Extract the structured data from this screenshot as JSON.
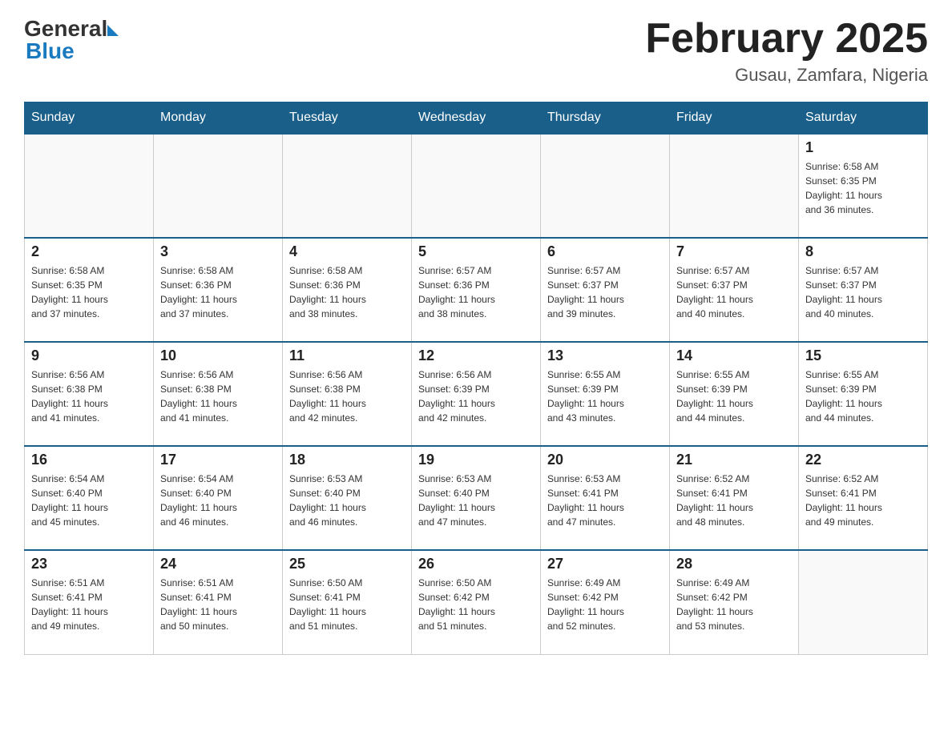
{
  "header": {
    "logo_general": "General",
    "logo_blue": "Blue",
    "month_title": "February 2025",
    "location": "Gusau, Zamfara, Nigeria"
  },
  "days_of_week": [
    "Sunday",
    "Monday",
    "Tuesday",
    "Wednesday",
    "Thursday",
    "Friday",
    "Saturday"
  ],
  "weeks": [
    [
      {
        "day": "",
        "info": ""
      },
      {
        "day": "",
        "info": ""
      },
      {
        "day": "",
        "info": ""
      },
      {
        "day": "",
        "info": ""
      },
      {
        "day": "",
        "info": ""
      },
      {
        "day": "",
        "info": ""
      },
      {
        "day": "1",
        "info": "Sunrise: 6:58 AM\nSunset: 6:35 PM\nDaylight: 11 hours\nand 36 minutes."
      }
    ],
    [
      {
        "day": "2",
        "info": "Sunrise: 6:58 AM\nSunset: 6:35 PM\nDaylight: 11 hours\nand 37 minutes."
      },
      {
        "day": "3",
        "info": "Sunrise: 6:58 AM\nSunset: 6:36 PM\nDaylight: 11 hours\nand 37 minutes."
      },
      {
        "day": "4",
        "info": "Sunrise: 6:58 AM\nSunset: 6:36 PM\nDaylight: 11 hours\nand 38 minutes."
      },
      {
        "day": "5",
        "info": "Sunrise: 6:57 AM\nSunset: 6:36 PM\nDaylight: 11 hours\nand 38 minutes."
      },
      {
        "day": "6",
        "info": "Sunrise: 6:57 AM\nSunset: 6:37 PM\nDaylight: 11 hours\nand 39 minutes."
      },
      {
        "day": "7",
        "info": "Sunrise: 6:57 AM\nSunset: 6:37 PM\nDaylight: 11 hours\nand 40 minutes."
      },
      {
        "day": "8",
        "info": "Sunrise: 6:57 AM\nSunset: 6:37 PM\nDaylight: 11 hours\nand 40 minutes."
      }
    ],
    [
      {
        "day": "9",
        "info": "Sunrise: 6:56 AM\nSunset: 6:38 PM\nDaylight: 11 hours\nand 41 minutes."
      },
      {
        "day": "10",
        "info": "Sunrise: 6:56 AM\nSunset: 6:38 PM\nDaylight: 11 hours\nand 41 minutes."
      },
      {
        "day": "11",
        "info": "Sunrise: 6:56 AM\nSunset: 6:38 PM\nDaylight: 11 hours\nand 42 minutes."
      },
      {
        "day": "12",
        "info": "Sunrise: 6:56 AM\nSunset: 6:39 PM\nDaylight: 11 hours\nand 42 minutes."
      },
      {
        "day": "13",
        "info": "Sunrise: 6:55 AM\nSunset: 6:39 PM\nDaylight: 11 hours\nand 43 minutes."
      },
      {
        "day": "14",
        "info": "Sunrise: 6:55 AM\nSunset: 6:39 PM\nDaylight: 11 hours\nand 44 minutes."
      },
      {
        "day": "15",
        "info": "Sunrise: 6:55 AM\nSunset: 6:39 PM\nDaylight: 11 hours\nand 44 minutes."
      }
    ],
    [
      {
        "day": "16",
        "info": "Sunrise: 6:54 AM\nSunset: 6:40 PM\nDaylight: 11 hours\nand 45 minutes."
      },
      {
        "day": "17",
        "info": "Sunrise: 6:54 AM\nSunset: 6:40 PM\nDaylight: 11 hours\nand 46 minutes."
      },
      {
        "day": "18",
        "info": "Sunrise: 6:53 AM\nSunset: 6:40 PM\nDaylight: 11 hours\nand 46 minutes."
      },
      {
        "day": "19",
        "info": "Sunrise: 6:53 AM\nSunset: 6:40 PM\nDaylight: 11 hours\nand 47 minutes."
      },
      {
        "day": "20",
        "info": "Sunrise: 6:53 AM\nSunset: 6:41 PM\nDaylight: 11 hours\nand 47 minutes."
      },
      {
        "day": "21",
        "info": "Sunrise: 6:52 AM\nSunset: 6:41 PM\nDaylight: 11 hours\nand 48 minutes."
      },
      {
        "day": "22",
        "info": "Sunrise: 6:52 AM\nSunset: 6:41 PM\nDaylight: 11 hours\nand 49 minutes."
      }
    ],
    [
      {
        "day": "23",
        "info": "Sunrise: 6:51 AM\nSunset: 6:41 PM\nDaylight: 11 hours\nand 49 minutes."
      },
      {
        "day": "24",
        "info": "Sunrise: 6:51 AM\nSunset: 6:41 PM\nDaylight: 11 hours\nand 50 minutes."
      },
      {
        "day": "25",
        "info": "Sunrise: 6:50 AM\nSunset: 6:41 PM\nDaylight: 11 hours\nand 51 minutes."
      },
      {
        "day": "26",
        "info": "Sunrise: 6:50 AM\nSunset: 6:42 PM\nDaylight: 11 hours\nand 51 minutes."
      },
      {
        "day": "27",
        "info": "Sunrise: 6:49 AM\nSunset: 6:42 PM\nDaylight: 11 hours\nand 52 minutes."
      },
      {
        "day": "28",
        "info": "Sunrise: 6:49 AM\nSunset: 6:42 PM\nDaylight: 11 hours\nand 53 minutes."
      },
      {
        "day": "",
        "info": ""
      }
    ]
  ]
}
